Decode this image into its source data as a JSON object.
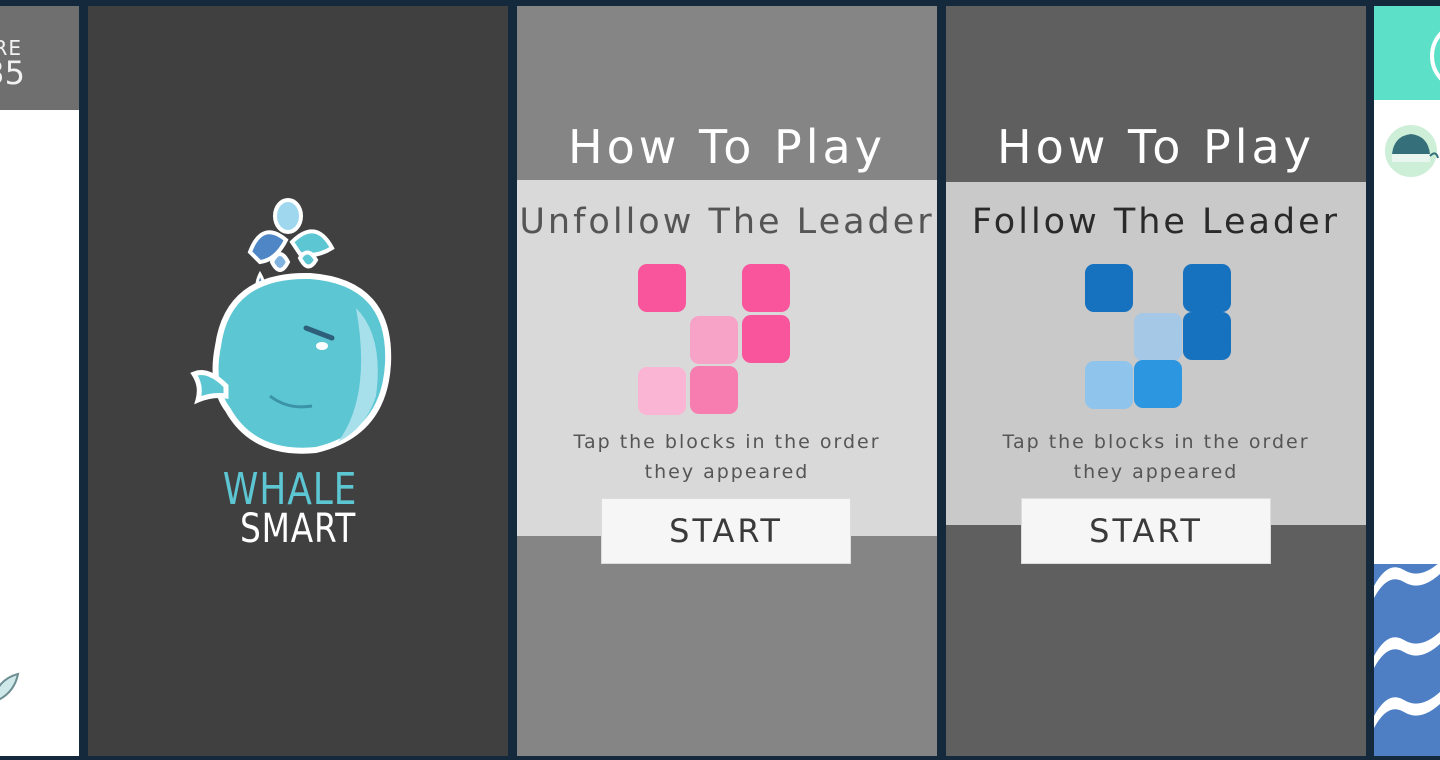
{
  "score_screen": {
    "label": "RE",
    "value": "35",
    "header_color": "#6f6f6f"
  },
  "splash": {
    "logo_icon": "whale-icon",
    "word1": "WHALE",
    "word2": "SMART",
    "word1_color": "#5cc6d3"
  },
  "unfollow_howto": {
    "title": "How To Play",
    "mode": "Unfollow The Leader",
    "instruction_line1": "Tap the blocks in the order",
    "instruction_line2": "they appeared",
    "start_label": "START",
    "block_colors": [
      "#f9559c",
      "#f9559c",
      "#f7a3c8",
      "#f9559c",
      "#fbb5d4",
      "#f77db1"
    ]
  },
  "follow_howto": {
    "title": "How To Play",
    "mode": "Follow The Leader",
    "instruction_line1": "Tap the blocks in the order",
    "instruction_line2": "they appeared",
    "start_label": "START",
    "block_colors": [
      "#1672bf",
      "#1672bf",
      "#a4c8e6",
      "#1672bf",
      "#8fc4ec",
      "#2c96e0"
    ]
  },
  "game_screen": {
    "top_bar_color": "#5de0c8",
    "sea_color": "#4e7fc4",
    "avatar_icon": "whale-avatar-icon"
  }
}
